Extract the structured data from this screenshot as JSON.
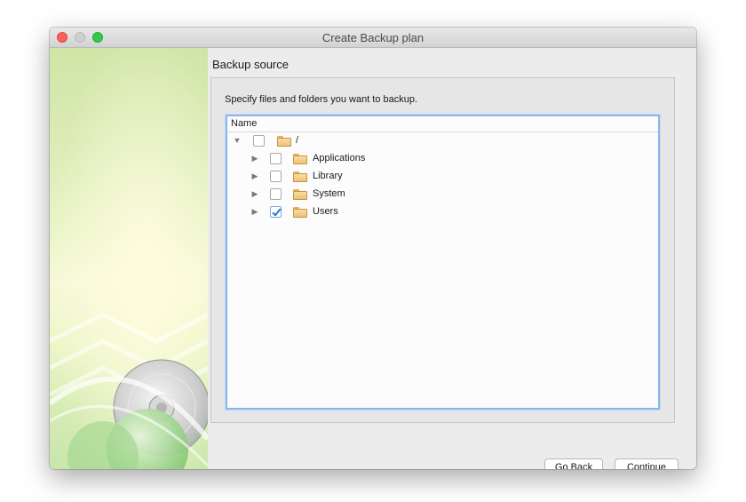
{
  "window": {
    "title": "Create Backup plan"
  },
  "section": {
    "title": "Backup source",
    "instruction": "Specify files and folders you want to backup."
  },
  "tree": {
    "column_header": "Name",
    "root": {
      "label": "/",
      "expanded": true,
      "checked": false
    },
    "children": [
      {
        "label": "Applications",
        "expanded": false,
        "checked": false
      },
      {
        "label": "Library",
        "expanded": false,
        "checked": false
      },
      {
        "label": "System",
        "expanded": false,
        "checked": false
      },
      {
        "label": "Users",
        "expanded": false,
        "checked": true
      }
    ]
  },
  "buttons": {
    "back": "Go Back",
    "continue": "Continue"
  },
  "icons": {
    "expanded": "triangle-down",
    "collapsed": "triangle-right",
    "folder": "folder-icon"
  },
  "colors": {
    "accent": "#2c6fd6",
    "focus_ring": "#8ab6ee"
  }
}
